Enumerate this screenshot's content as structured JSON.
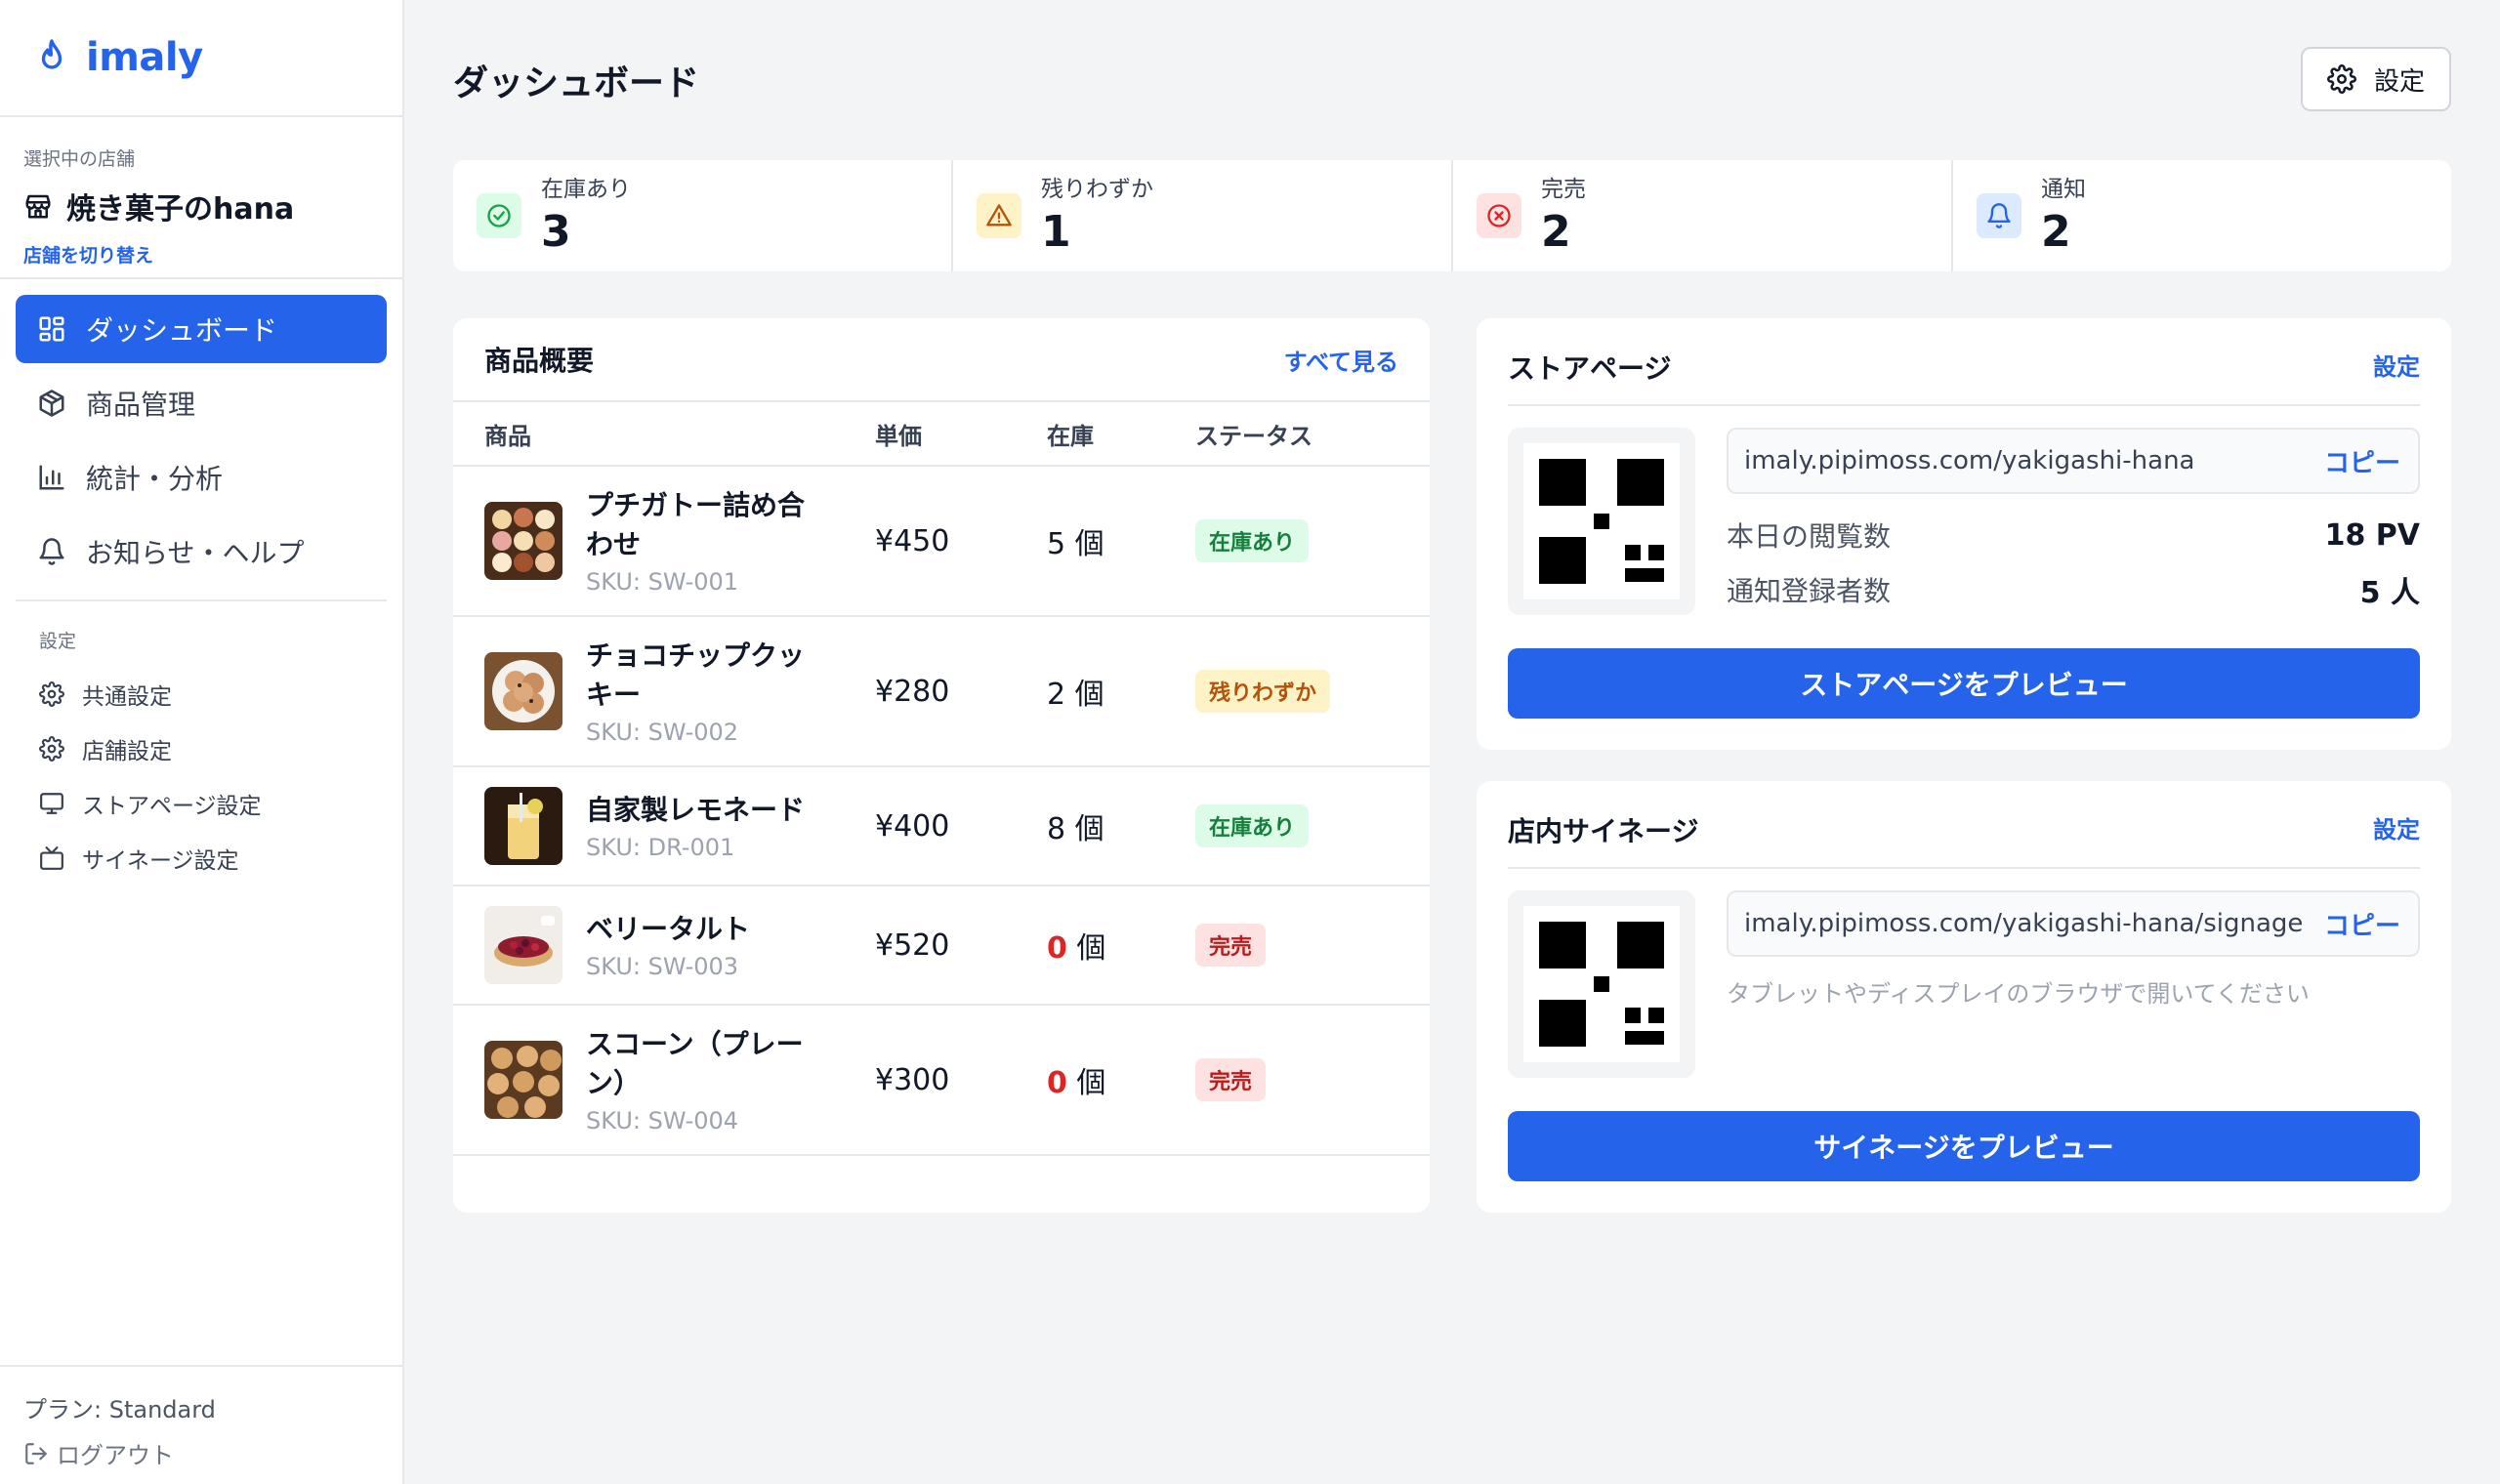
{
  "sidebar": {
    "logo": "imaly",
    "store_caption": "選択中の店舗",
    "store_name": "焼き菓子のhana",
    "store_switch": "店舗を切り替え",
    "nav": [
      {
        "label": "ダッシュボード",
        "icon": "grid-icon",
        "active": true
      },
      {
        "label": "商品管理",
        "icon": "box-icon"
      },
      {
        "label": "統計・分析",
        "icon": "bar-chart-icon"
      },
      {
        "label": "お知らせ・ヘルプ",
        "icon": "bell-icon"
      }
    ],
    "settings_caption": "設定",
    "settings_items": [
      {
        "label": "共通設定",
        "icon": "gear-icon"
      },
      {
        "label": "店舗設定",
        "icon": "gear-icon"
      },
      {
        "label": "ストアページ設定",
        "icon": "monitor-icon"
      },
      {
        "label": "サイネージ設定",
        "icon": "tv-icon"
      }
    ],
    "plan": "プラン: Standard",
    "logout": "ログアウト"
  },
  "header": {
    "title": "ダッシュボード",
    "settings_label": "設定"
  },
  "stats": [
    {
      "label": "在庫あり",
      "value": "3",
      "icon": "check-circle-icon",
      "color": "#16a34a",
      "bg": "#dcfce7"
    },
    {
      "label": "残りわずか",
      "value": "1",
      "icon": "warning-icon",
      "color": "#b45309",
      "bg": "#fef3c7"
    },
    {
      "label": "完売",
      "value": "2",
      "icon": "x-circle-icon",
      "color": "#dc2626",
      "bg": "#fee2e2"
    },
    {
      "label": "通知",
      "value": "2",
      "icon": "bell-icon",
      "color": "#2563eb",
      "bg": "#dbeafe"
    }
  ],
  "products": {
    "title": "商品概要",
    "view_all": "すべて見る",
    "columns": [
      "商品",
      "単価",
      "在庫",
      "ステータス"
    ],
    "rows": [
      {
        "name": "プチガトー詰め合わせ",
        "sku": "SKU: SW-001",
        "price": "¥450",
        "stock": "5",
        "unit": "個",
        "status": "在庫あり",
        "status_type": "green"
      },
      {
        "name": "チョコチップクッキー",
        "sku": "SKU: SW-002",
        "price": "¥280",
        "stock": "2",
        "unit": "個",
        "status": "残りわずか",
        "status_type": "yellow"
      },
      {
        "name": "自家製レモネード",
        "sku": "SKU: DR-001",
        "price": "¥400",
        "stock": "8",
        "unit": "個",
        "status": "在庫あり",
        "status_type": "green"
      },
      {
        "name": "ベリータルト",
        "sku": "SKU: SW-003",
        "price": "¥520",
        "stock": "0",
        "unit": "個",
        "status": "完売",
        "status_type": "red"
      },
      {
        "name": "スコーン（プレーン）",
        "sku": "SKU: SW-004",
        "price": "¥300",
        "stock": "0",
        "unit": "個",
        "status": "完売",
        "status_type": "red"
      }
    ]
  },
  "store_page": {
    "title": "ストアページ",
    "settings_link": "設定",
    "url": "imaly.pipimoss.com/yakigashi-hana",
    "copy_label": "コピー",
    "views_label": "本日の閲覧数",
    "views_value": "18 PV",
    "subscribers_label": "通知登録者数",
    "subscribers_value": "5 人",
    "preview_label": "ストアページをプレビュー"
  },
  "signage": {
    "title": "店内サイネージ",
    "settings_link": "設定",
    "url": "imaly.pipimoss.com/yakigashi-hana/signage",
    "copy_label": "コピー",
    "hint": "タブレットやディスプレイのブラウザで開いてください",
    "preview_label": "サイネージをプレビュー"
  }
}
